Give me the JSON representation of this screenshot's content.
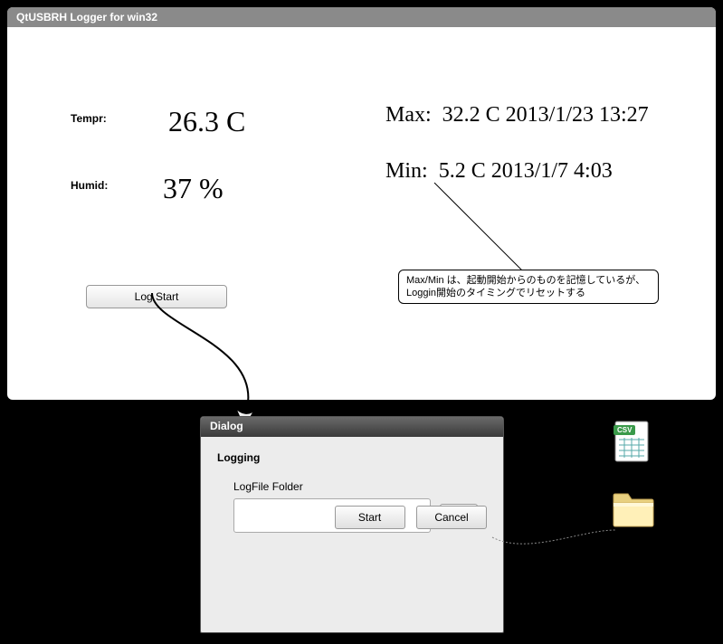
{
  "window": {
    "title": "QtUSBRH Logger for win32"
  },
  "readings": {
    "tempr_label": "Tempr:",
    "tempr_value": "26.3 C",
    "humid_label": "Humid:",
    "humid_value": "37 %"
  },
  "stats": {
    "max_label": "Max:",
    "max_value": "32.2 C 2013/1/23 13:27",
    "min_label": "Min:",
    "min_value": "5.2 C 2013/1/7 4:03"
  },
  "callout": {
    "line1": "Max/Min は、起動開始からのものを記憶しているが、",
    "line2": "Loggin開始のタイミングでリセットする"
  },
  "buttons": {
    "log_start": "Log Start"
  },
  "dialog": {
    "title": "Dialog",
    "group": "Logging",
    "field_label": "LogFile Folder",
    "folder_value": "",
    "browse": "...",
    "start": "Start",
    "cancel": "Cancel"
  },
  "icons": {
    "csv": "csv-file-icon",
    "folder": "folder-icon"
  }
}
